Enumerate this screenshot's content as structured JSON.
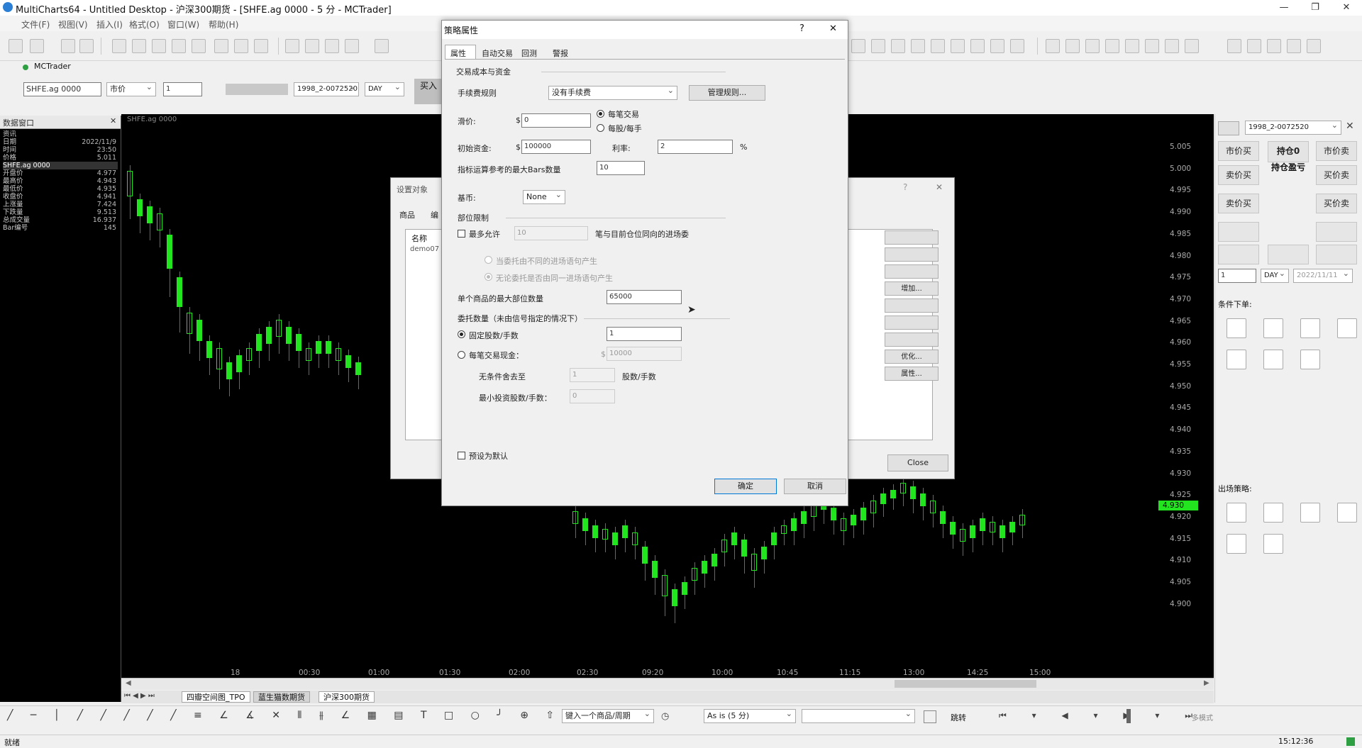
{
  "window": {
    "title": "MultiCharts64 - Untitled Desktop - 沪深300期货 - [SHFE.ag 0000 - 5 分 - MCTrader]"
  },
  "menu": [
    "文件(F)",
    "视图(V)",
    "插入(I)",
    "格式(O)",
    "窗口(W)",
    "帮助(H)"
  ],
  "trader_tab": "MCTrader",
  "order_bar": {
    "symbol": "SHFE.ag 0000",
    "order_type": "市价",
    "qty": "1",
    "account": "1998_2-0072520",
    "tif": "DAY",
    "buy_label": "买入"
  },
  "data_window": {
    "title": "数据窗口",
    "rows": [
      {
        "label": "资讯",
        "value": ""
      },
      {
        "label": "日期",
        "value": "2022/11/9"
      },
      {
        "label": "时间",
        "value": "23:50"
      },
      {
        "label": "价格",
        "value": "5.011"
      },
      {
        "label": "SHFE.ag 0000",
        "value": ""
      },
      {
        "label": "开盘价",
        "value": "4.977"
      },
      {
        "label": "最高价",
        "value": "4.943"
      },
      {
        "label": "最低价",
        "value": "4.935"
      },
      {
        "label": "收盘价",
        "value": "4.941"
      },
      {
        "label": "上涨量",
        "value": "7.424"
      },
      {
        "label": "下跌量",
        "value": "9.513"
      },
      {
        "label": "总成交量",
        "value": "16.937"
      },
      {
        "label": "Bar编号",
        "value": "145"
      }
    ]
  },
  "chart": {
    "symbol_label": "SHFE.ag 0000",
    "price_labels": [
      "5.005",
      "5.000",
      "4.995",
      "4.990",
      "4.985",
      "4.980",
      "4.975",
      "4.970",
      "4.965",
      "4.960",
      "4.955",
      "4.950",
      "4.945",
      "4.940",
      "4.935",
      "4.930",
      "4.925",
      "4.920",
      "4.915",
      "4.910",
      "4.905",
      "4.900"
    ],
    "current_price": "4.930",
    "time_labels": [
      "18",
      "00:30",
      "01:00",
      "01:30",
      "02:00",
      "02:30",
      "09:20",
      "10:00",
      "10:45",
      "11:15",
      "13:00",
      "14:25",
      "15:00"
    ]
  },
  "sheet_tabs": [
    "四瓣空间图_TPO",
    "蓝生猫数期货",
    "沪深300期货"
  ],
  "right_panel": {
    "account": "1998_2-0072520",
    "btn_market_buy": "市价买",
    "btn_position": "持仓0",
    "btn_pnl": "持仓盈亏",
    "btn_market_sell": "市价卖",
    "btn_sell_buy": "卖价买",
    "btn_buy_sell": "买价卖",
    "btn_sell_buy2": "卖价买",
    "btn_buy_sell2": "买价卖",
    "qty": "1",
    "tif": "DAY",
    "date": "2022/11/11",
    "conditional_title": "条件下单:",
    "exit_title": "出场策略:"
  },
  "background_dialog": {
    "title": "设置对象",
    "tab1": "商品",
    "tab2": "编",
    "col_name": "名称",
    "item": "demo07",
    "btn_add": "增加...",
    "btn_optimize": "优化...",
    "btn_properties": "属性...",
    "btn_close": "Close"
  },
  "dialog": {
    "title": "策略属性",
    "tabs": [
      "属性",
      "自动交易",
      "回测",
      "警报"
    ],
    "section_cost": "交易成本与资金",
    "commission_label": "手续费规则",
    "commission_value": "没有手续费",
    "manage_rules": "管理规则...",
    "slippage_label": "滑价:",
    "slippage_value": "0",
    "per_trade": "每笔交易",
    "per_contract": "每股/每手",
    "initial_capital_label": "初始资金:",
    "initial_capital_value": "100000",
    "interest_label": "利率:",
    "interest_value": "2",
    "percent": "%",
    "max_bars_label": "指标运算参考的最大Bars数量",
    "max_bars_value": "10",
    "base_currency_label": "基币:",
    "base_currency_value": "None",
    "section_position": "部位限制",
    "max_allow_label": "最多允许",
    "max_allow_value": "10",
    "max_allow_suffix": "笔与目前仓位同向的进场委",
    "opt_diff_signal": "当委托由不同的进场语句产生",
    "opt_same_signal": "无论委托是否由同一进场语句产生",
    "max_shares_label": "单个商品的最大部位数量",
    "max_shares_value": "65000",
    "order_qty_label": "委托数量（未由信号指定的情况下）",
    "fixed_shares_label": "固定股数/手数",
    "fixed_shares_value": "1",
    "cash_per_trade_label": "每笔交易现金：",
    "cash_symbol": "$",
    "cash_per_trade_value": "10000",
    "round_down_label": "无条件舍去至",
    "round_down_value": "1",
    "round_down_suffix": "股数/手数",
    "min_shares_label": "最小投资股数/手数：",
    "min_shares_value": "0",
    "default_label": "预设为默认",
    "ok": "确定",
    "cancel": "取消",
    "help": "?",
    "close": "✕"
  },
  "drawbar": {
    "symbol_prompt": "键入一个商品/周期",
    "bar_mode": "As is (5 分)",
    "jump": "跳转",
    "multi_mode": "多模式"
  },
  "status": {
    "left": "就绪",
    "time": "15:12:36"
  },
  "colors": {
    "candle": "#22e51f",
    "chart_bg": "#000000",
    "price_marker": "#22e51f"
  }
}
